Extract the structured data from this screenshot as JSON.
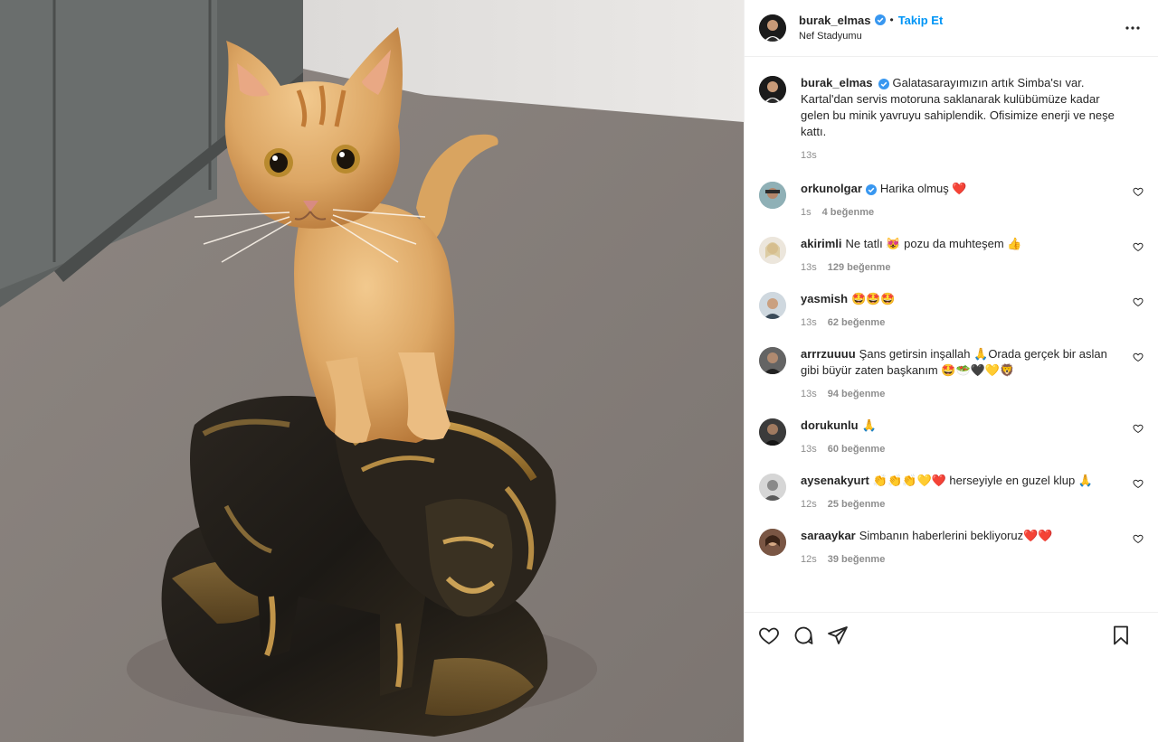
{
  "post": {
    "username": "burak_elmas",
    "follow_label": "Takip Et",
    "separator": "•",
    "location": "Nef Stadyumu",
    "more_label": "•••"
  },
  "caption": {
    "username": "burak_elmas",
    "text": "Galatasarayımızın artık Simba'sı var. Kartal'dan servis motoruna saklanarak kulübümüze kadar gelen bu minik yavruyu sahiplendik. Ofisimize enerji ve neşe kattı.",
    "time": "13s"
  },
  "comments": [
    {
      "username": "orkunolgar",
      "verified": true,
      "text": "Harika olmuş ❤️",
      "time": "1s",
      "likes": "4 beğenme"
    },
    {
      "username": "akirimli",
      "verified": false,
      "text": "Ne tatlı 😻 pozu da muhteşem 👍",
      "time": "13s",
      "likes": "129 beğenme"
    },
    {
      "username": "yasmish",
      "verified": false,
      "text": "🤩🤩🤩",
      "time": "13s",
      "likes": "62 beğenme"
    },
    {
      "username": "arrrzuuuu",
      "verified": false,
      "text": "Şans getirsin inşallah 🙏Orada gerçek bir aslan gibi büyür zaten başkanım 🤩🥗🖤💛🦁",
      "time": "13s",
      "likes": "94 beğenme"
    },
    {
      "username": "dorukunlu",
      "verified": false,
      "text": "🙏",
      "time": "13s",
      "likes": "60 beğenme"
    },
    {
      "username": "aysenakyurt",
      "verified": false,
      "text": "👏👏👏💛❤️ herseyiyle en guzel klup 🙏",
      "time": "12s",
      "likes": "25 beğenme"
    },
    {
      "username": "saraaykar",
      "verified": false,
      "text": "Simbanın haberlerini bekliyoruz❤️❤️",
      "time": "12s",
      "likes": "39 beğenme"
    }
  ],
  "icons": {
    "like": "heart-icon",
    "comment": "comment-icon",
    "share": "share-icon",
    "save": "bookmark-icon"
  },
  "colors": {
    "accent": "#0095f6",
    "verified": "#3897f0",
    "text": "#262626",
    "muted": "#8e8e8e"
  }
}
